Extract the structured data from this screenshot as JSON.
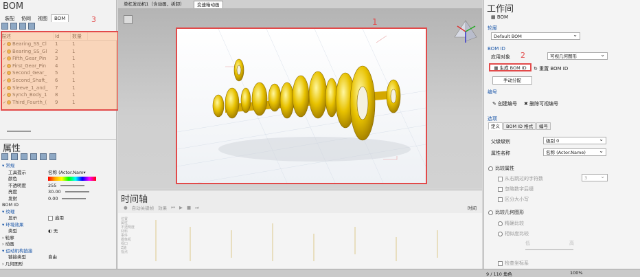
{
  "bom": {
    "title": "BOM",
    "tabs": [
      "装配",
      "协同",
      "视图",
      "BOM"
    ],
    "active_tab": "BOM",
    "annotation": "3",
    "columns": [
      "描述",
      "Id",
      "数量"
    ],
    "rows": [
      {
        "desc": "Bearing_SS_Cl",
        "id": "1",
        "qty": "1"
      },
      {
        "desc": "Bearing_SS_Gl",
        "id": "2",
        "qty": "1"
      },
      {
        "desc": "Fifth_Gear_Pin",
        "id": "3",
        "qty": "1"
      },
      {
        "desc": "First_Gear_Pin",
        "id": "4",
        "qty": "1"
      },
      {
        "desc": "Second_Gear_",
        "id": "5",
        "qty": "1"
      },
      {
        "desc": "Second_Shaft_",
        "id": "6",
        "qty": "1"
      },
      {
        "desc": "Sleeve_1_and_",
        "id": "7",
        "qty": "1"
      },
      {
        "desc": "Synch_Body_1",
        "id": "8",
        "qty": "1"
      },
      {
        "desc": "Third_Fourth_(",
        "id": "9",
        "qty": "1"
      }
    ]
  },
  "properties": {
    "title": "属性",
    "section_general": "常规",
    "tooltip_key": "工具提示",
    "tooltip_val": "名称 (Actor.Nam▾",
    "color_key": "颜色",
    "opacity_key": "不透明度",
    "opacity_val": "255",
    "brightness_key": "亮度",
    "brightness_val": "30.00",
    "emissive_key": "发射",
    "emissive_val": "0.00",
    "bomid_key": "BOM ID",
    "section_texture": "纹理",
    "display_key": "显示",
    "display_val": "启用",
    "section_env": "环境效果",
    "type_key": "类型",
    "type_val": "无",
    "section_outline": "轮廓",
    "section_anim": "动画",
    "section_mech": "运动机构链接",
    "link_type_key": "链接类型",
    "link_type_val": "自由",
    "section_geom": "几何图形"
  },
  "doc_tabs": [
    "单杠发动机1（含动画，拆卸）",
    "变速箱动画"
  ],
  "viewport": {
    "annotation": "1"
  },
  "timeline": {
    "title": "时间轴",
    "auto_key": "自动关键帧",
    "effects": "效果",
    "time_label": "时间",
    "track_labels": [
      "位置",
      "属性",
      "不透明度",
      "材料",
      "事件",
      "摄像机",
      "视口",
      "Z轴",
      "视点"
    ]
  },
  "workspace": {
    "title": "工作间",
    "bom_item": "BOM",
    "section_outline": "轮廓",
    "default_bom": "Default BOM",
    "section_bomid": "BOM ID",
    "apply_to": "应用对象",
    "apply_val": "可视几何图形",
    "annotation": "2",
    "gen_bomid": "生成 BOM ID",
    "reset_bomid": "重置 BOM ID",
    "manual_assign": "手动分配",
    "section_number": "编号",
    "create_number": "创建编号",
    "delete_visible_number": "删除可视编号",
    "section_options": "选项",
    "opt_tabs": [
      "定义",
      "BOM ID 格式",
      "编号"
    ],
    "parent_level": "父级级别",
    "parent_level_val": "级别 0",
    "prop_name": "属性名称",
    "prop_name_val": "名称 (Actor.Name)",
    "compare_props": "比较属性",
    "skip_chars": "从右跳过的字符数",
    "skip_chars_val": "3",
    "ignore_trailing_digits": "忽略数字后缀",
    "case_sensitive": "区分大小写",
    "compare_geom": "比较几何图形",
    "exact_compare": "精确比较",
    "similarity_compare": "相似度比较",
    "low": "低",
    "high": "高",
    "check_coords": "检查坐标系"
  },
  "status": {
    "count": "9 / 110 角色",
    "zoom": "100%"
  },
  "colors": {
    "highlight_red": "#e24a4a",
    "bom_fill": "#ffd0a8",
    "link_blue": "#1a56a8",
    "gear_yellow": "#e8c200"
  }
}
